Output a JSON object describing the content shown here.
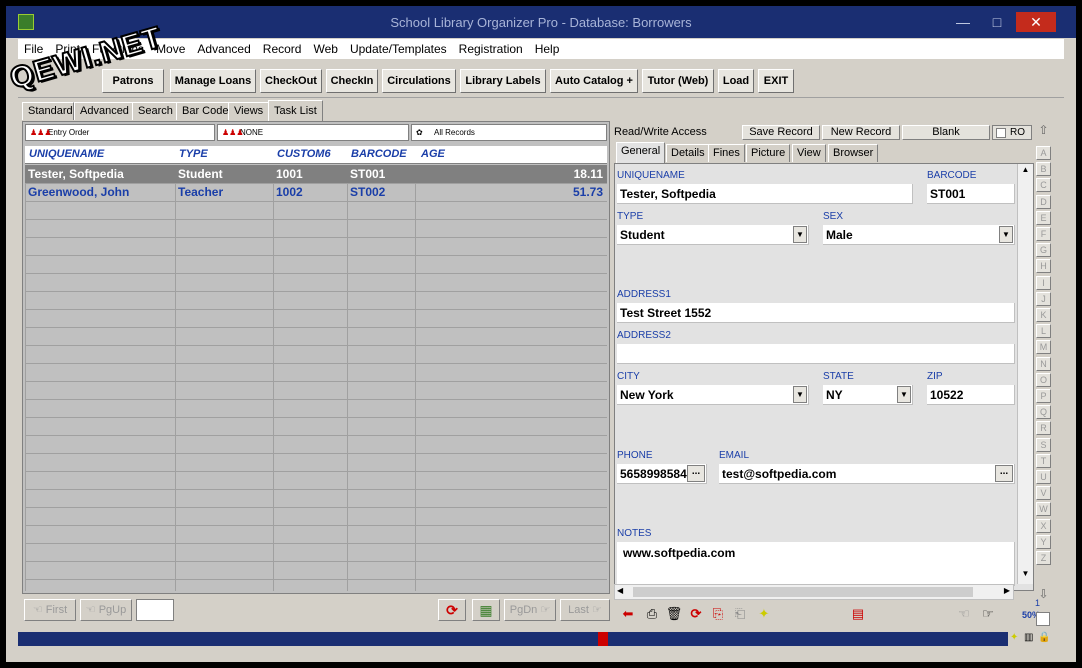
{
  "window": {
    "title": "School Library Organizer Pro - Database: Borrowers",
    "close": "✕",
    "maximize": "□",
    "minimize": "—"
  },
  "watermark": "QEWI.NET",
  "menu": [
    "File",
    "Print",
    "Functions",
    "Move",
    "Advanced",
    "Record",
    "Web",
    "Update/Templates",
    "Registration",
    "Help"
  ],
  "toolbar": [
    "Patrons",
    "Manage Loans",
    "CheckOut",
    "CheckIn",
    "Circulations",
    "Library Labels",
    "Auto Catalog +",
    "Tutor (Web)",
    "Load",
    "EXIT"
  ],
  "left_tabs": [
    "Standard",
    "Advanced",
    "Search",
    "Bar Code",
    "Views",
    "Task List"
  ],
  "selectors": {
    "order": "Entry Order",
    "filter": "NONE",
    "records": "All Records"
  },
  "grid": {
    "columns": [
      "UNIQUENAME",
      "TYPE",
      "CUSTOM6",
      "BARCODE",
      "AGE"
    ],
    "rows": [
      {
        "name": "Tester, Softpedia",
        "type": "Student",
        "custom6": "1001",
        "barcode": "ST001",
        "age": "18.11"
      },
      {
        "name": "Greenwood,  John",
        "type": "Teacher",
        "custom6": "1002",
        "barcode": "ST002",
        "age": "51.73"
      }
    ]
  },
  "nav": {
    "first": "First",
    "pgup": "PgUp",
    "pgdn": "PgDn",
    "last": "Last"
  },
  "record_bar": {
    "access": "Read/Write Access",
    "save": "Save Record",
    "new": "New Record",
    "blank": "Blank",
    "ro": "RO"
  },
  "right_tabs": [
    "General",
    "Details",
    "Fines",
    "Picture",
    "View",
    "Browser"
  ],
  "form": {
    "uniquename_label": "UNIQUENAME",
    "uniquename": "Tester, Softpedia",
    "barcode_label": "BARCODE",
    "barcode": "ST001",
    "type_label": "TYPE",
    "type": "Student",
    "sex_label": "SEX",
    "sex": "Male",
    "address1_label": "ADDRESS1",
    "address1": "Test Street 1552",
    "address2_label": "ADDRESS2",
    "address2": "",
    "city_label": "CITY",
    "city": "New York",
    "state_label": "STATE",
    "state": "NY",
    "zip_label": "ZIP",
    "zip": "10522",
    "phone_label": "PHONE",
    "phone": "5658998584",
    "email_label": "EMAIL",
    "email": "test@softpedia.com",
    "notes_label": "NOTES",
    "notes": "www.softpedia.com"
  },
  "alphabet": [
    "A",
    "B",
    "C",
    "D",
    "E",
    "F",
    "G",
    "H",
    "I",
    "J",
    "K",
    "L",
    "M",
    "N",
    "O",
    "P",
    "Q",
    "R",
    "S",
    "T",
    "U",
    "V",
    "W",
    "X",
    "Y",
    "Z"
  ],
  "record_position": {
    "index": "1",
    "zoom": "50%"
  },
  "colors": {
    "titlebar": "#1a2e72",
    "selected_row": "#808080",
    "label_blue": "#1a3ea8"
  }
}
